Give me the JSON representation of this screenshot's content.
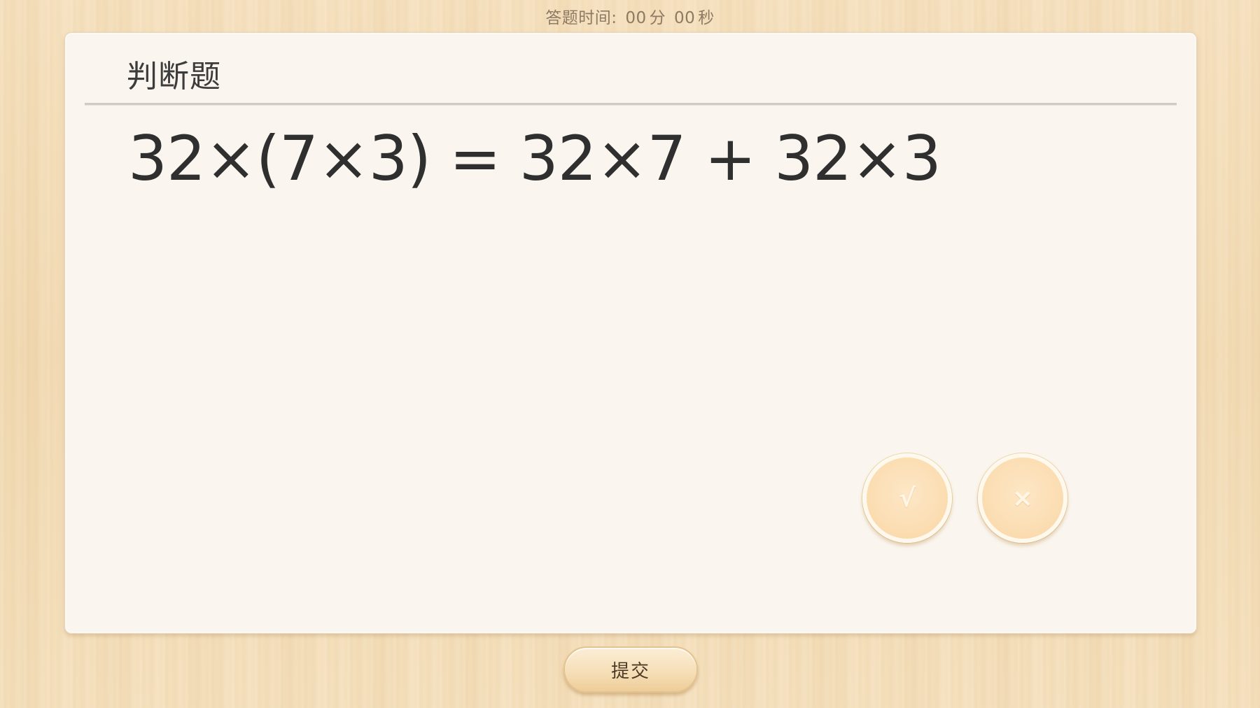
{
  "timer": {
    "label": "答题时间:",
    "minutes": "00",
    "minutes_unit": "分",
    "seconds": "00",
    "seconds_unit": "秒"
  },
  "question": {
    "type_title": "判断题",
    "equation": "32×(7×3) = 32×7 + 32×3"
  },
  "choices": {
    "true_symbol": "√",
    "false_symbol": "×"
  },
  "submit": {
    "label": "提交"
  },
  "colors": {
    "background": "#f3dcb6",
    "card": "#faf6ef",
    "choice_fill": "#fbdcb0",
    "text": "#2f2f2f"
  }
}
